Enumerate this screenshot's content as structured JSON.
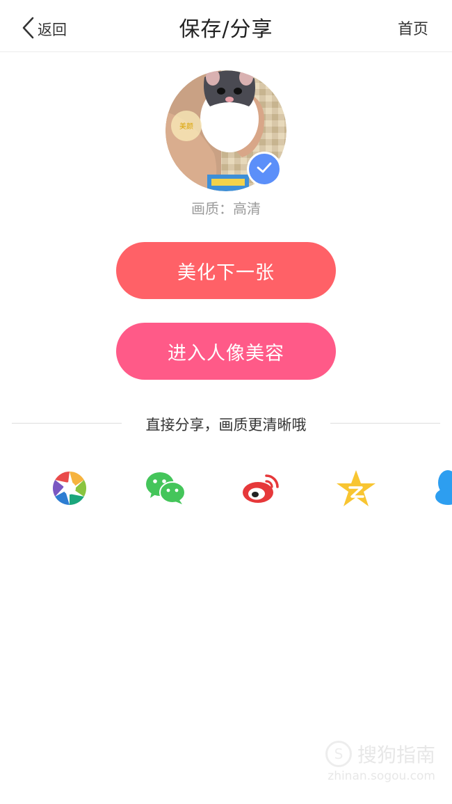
{
  "header": {
    "back_label": "返回",
    "title": "保存/分享",
    "home_label": "首页"
  },
  "preview": {
    "quality_text": "画质：高清",
    "badge_text": "美颜"
  },
  "buttons": {
    "next_label": "美化下一张",
    "portrait_label": "进入人像美容"
  },
  "share": {
    "heading": "直接分享，画质更清晰哦",
    "targets": [
      "moments-icon",
      "wechat-icon",
      "weibo-icon",
      "qzone-icon",
      "qq-icon"
    ]
  },
  "watermark": {
    "logo_char": "S",
    "main": "搜狗指南",
    "sub": "zhinan.sogou.com"
  },
  "colors": {
    "next_button": "#ff6167",
    "portrait_button": "#ff5a88",
    "check_badge": "#5b8ff9",
    "wechat": "#44c55a",
    "weibo": "#e6383a",
    "qzone": "#f8c531",
    "qq": "#2d9ef0"
  }
}
